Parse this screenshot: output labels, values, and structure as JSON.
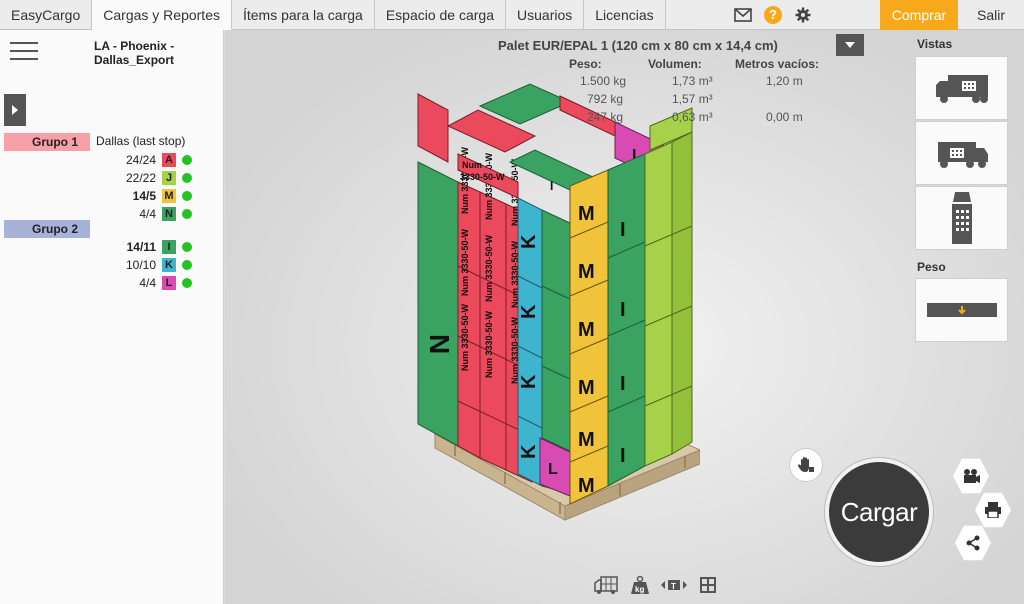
{
  "nav": {
    "tabs": [
      {
        "label": "EasyCargo"
      },
      {
        "label": "Cargas y Reportes"
      },
      {
        "label": "Ítems para la carga"
      },
      {
        "label": "Espacio de carga"
      },
      {
        "label": "Usuarios"
      },
      {
        "label": "Licencias"
      }
    ],
    "help_label": "?",
    "buy_label": "Comprar",
    "exit_label": "Salir",
    "icons": [
      "mail-icon",
      "help-icon",
      "gear-icon"
    ]
  },
  "left_panel": {
    "shipment_title_line1": "LA - Phoenix -",
    "shipment_title_line2": "Dallas_Export",
    "groups": [
      {
        "label": "Grupo 1",
        "color": "#f7a0a8"
      },
      {
        "label": "Grupo 2",
        "color": "#a7b2d8"
      }
    ],
    "stop_label": "Dallas (last stop)",
    "rows": [
      {
        "count": "24/24",
        "letter": "A",
        "color": "#ea4a5b",
        "bold": false
      },
      {
        "count": "22/22",
        "letter": "J",
        "color": "#a6d24a",
        "bold": false
      },
      {
        "count": "14/5",
        "letter": "M",
        "color": "#f0c33a",
        "bold": true
      },
      {
        "count": "4/4",
        "letter": "N",
        "color": "#3aa361",
        "bold": false
      },
      {
        "count": "14/11",
        "letter": "I",
        "color": "#3aa361",
        "bold": true
      },
      {
        "count": "10/10",
        "letter": "K",
        "color": "#3fb4cf",
        "bold": false
      },
      {
        "count": "4/4",
        "letter": "L",
        "color": "#d84bb3",
        "bold": false
      }
    ]
  },
  "info": {
    "title": "Palet EUR/EPAL 1 (120 cm x 80 cm x 14,4 cm)",
    "weight_header": "Peso:",
    "volume_header": "Volumen:",
    "meters_header": "Metros vacíos:",
    "row1": {
      "weight": "1.500 kg",
      "volume": "1,73 m³",
      "meters": "1,20 m"
    },
    "row2": {
      "weight": "792 kg",
      "volume": "1,57 m³",
      "meters": ""
    },
    "row3": {
      "weight": "247 kg",
      "volume": "0,63 m³",
      "meters": "0,00 m"
    }
  },
  "right_panel": {
    "views_label": "Vistas",
    "weight_label": "Peso",
    "view_icons": [
      "truck-side-view-icon",
      "truck-angle-view-icon",
      "truck-top-view-icon"
    ],
    "weight_icon": "weight-distribution-icon"
  },
  "actions": {
    "load_label": "Cargar",
    "camera_icon": "camera-icon",
    "print_icon": "print-icon",
    "share_icon": "share-icon",
    "hand_icon": "hand-drag-icon"
  },
  "bottom_tools": [
    "truck-grid-icon",
    "weight-kg-icon",
    "top-view-icon",
    "grid-layout-icon"
  ],
  "cargo_labels": {
    "A": "Num 3330-50-W",
    "M": "M",
    "N": "N",
    "I": "I",
    "K": "K",
    "L": "L"
  }
}
